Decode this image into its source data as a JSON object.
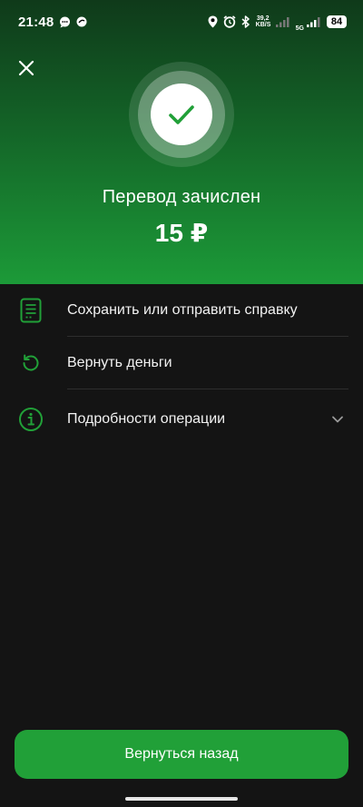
{
  "status_bar": {
    "time": "21:48",
    "net_speed_value": "39,2",
    "net_speed_unit": "KB/S",
    "network_label": "5G",
    "battery": "84"
  },
  "header": {
    "title": "Перевод зачислен",
    "amount": "15 ₽"
  },
  "actions": [
    {
      "label": "Сохранить или отправить справку",
      "icon": "document-icon"
    },
    {
      "label": "Вернуть деньги",
      "icon": "refund-icon"
    },
    {
      "label": "Подробности операции",
      "icon": "info-icon"
    }
  ],
  "footer": {
    "back_label": "Вернуться назад"
  },
  "colors": {
    "accent": "#21a038",
    "background": "#141414",
    "header_top": "#0f3a1a",
    "header_bottom": "#1c9a38"
  }
}
